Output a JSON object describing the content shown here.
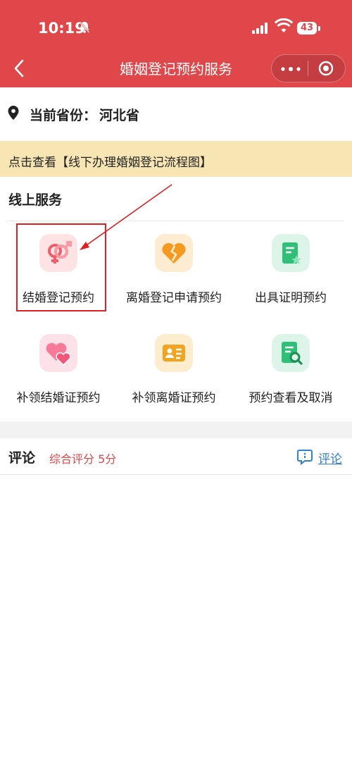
{
  "status_bar": {
    "time": "10:19",
    "battery": "43"
  },
  "nav": {
    "title": "婚姻登记预约服务"
  },
  "province": {
    "label": "当前省份：",
    "value": "河北省"
  },
  "banner": {
    "text": "点击查看【线下办理婚姻登记流程图】"
  },
  "online": {
    "title": "线上服务",
    "services": [
      {
        "label": "结婚登记预约",
        "icon": "gender-symbols-icon",
        "color": "#ef5f6b"
      },
      {
        "label": "离婚登记申请预约",
        "icon": "broken-heart-icon",
        "color": "#f39a1f"
      },
      {
        "label": "出具证明预约",
        "icon": "certificate-icon",
        "color": "#2fbf77"
      },
      {
        "label": "补领结婚证预约",
        "icon": "hearts-icon",
        "color": "#f0577a"
      },
      {
        "label": "补领离婚证预约",
        "icon": "id-card-icon",
        "color": "#f0a41f"
      },
      {
        "label": "预约查看及取消",
        "icon": "document-search-icon",
        "color": "#2fbf77"
      }
    ]
  },
  "comments": {
    "title": "评论",
    "rating": "综合评分 5分",
    "link": "评论"
  },
  "colors": {
    "brand": "#e0474a",
    "banner": "#f7e6b3",
    "link": "#2f80d1"
  }
}
